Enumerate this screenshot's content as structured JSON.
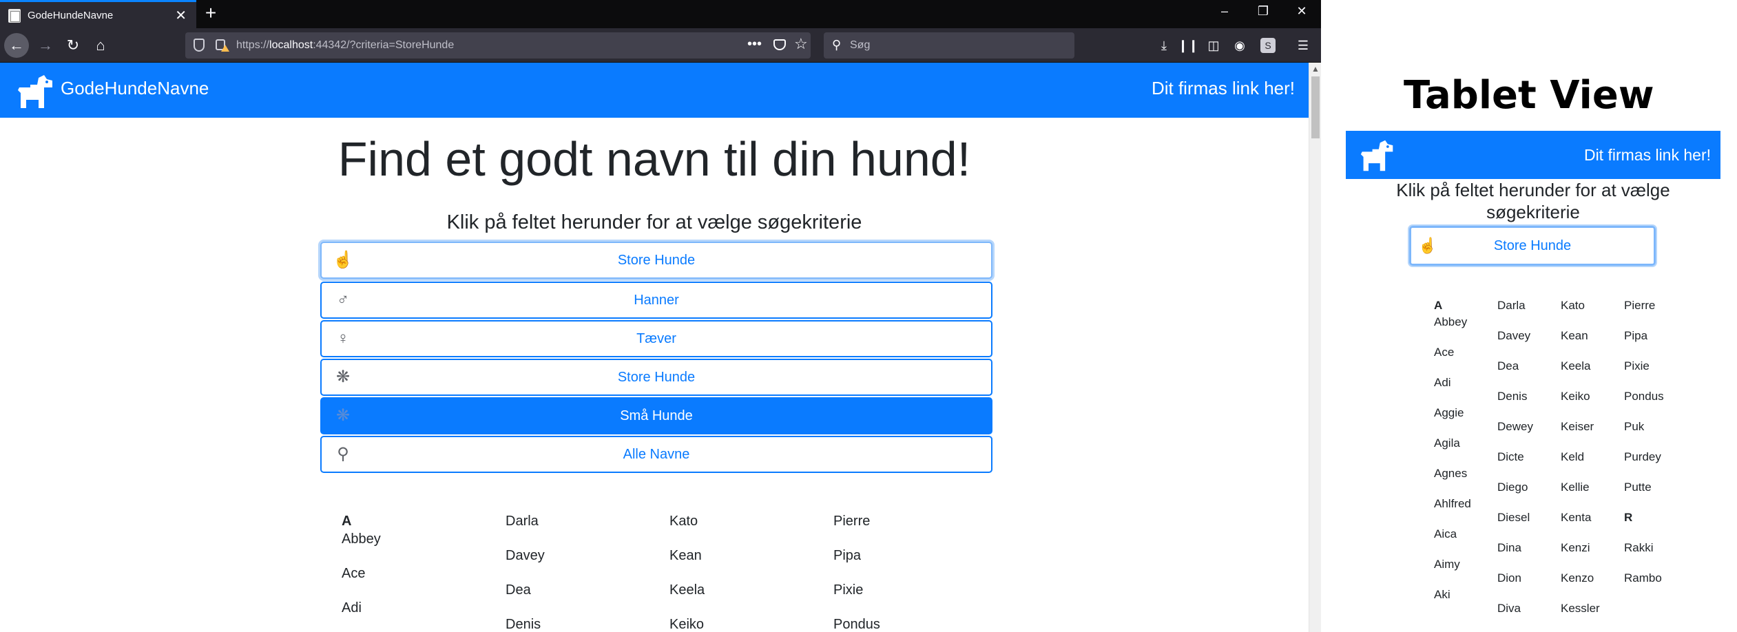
{
  "browser": {
    "tab_title": "GodeHundeNavne",
    "tab_close": "✕",
    "new_tab": "+",
    "window_controls": [
      "–",
      "❐",
      "✕"
    ],
    "url_prefix": "https://",
    "url_host": "localhost",
    "url_rest": ":44342/?criteria=StoreHunde",
    "search_placeholder": "Søg",
    "url_dots": "•••",
    "icons": [
      "back-icon",
      "forward-icon",
      "reload-icon",
      "home-icon",
      "shield-icon",
      "lock-icon",
      "pocket-icon",
      "star-icon",
      "download-icon",
      "library-icon",
      "sidebar-icon",
      "account-icon",
      "extension-icon",
      "menu-icon"
    ]
  },
  "site": {
    "brand": "GodeHundeNavne",
    "firm_link": "Dit firmas link her!",
    "headline": "Find et godt navn til din hund!",
    "subtitle": "Klik på feltet herunder for at vælge søgekriterie",
    "accent_color": "#0a7bff",
    "options": [
      {
        "label": "Store Hunde",
        "icon": "hand-pointer-icon",
        "state": "main-selector"
      },
      {
        "label": "Hanner",
        "icon": "male-icon",
        "state": "normal"
      },
      {
        "label": "Tæver",
        "icon": "female-icon",
        "state": "normal"
      },
      {
        "label": "Store Hunde",
        "icon": "paw-icon",
        "state": "normal"
      },
      {
        "label": "Små Hunde",
        "icon": "small-paw-icon",
        "state": "selected"
      },
      {
        "label": "Alle Navne",
        "icon": "search-icon",
        "state": "normal"
      }
    ],
    "names": {
      "col1": [
        {
          "letter": "A"
        },
        "Abbey",
        "Ace",
        "Adi"
      ],
      "col2": [
        "Darla",
        "Davey",
        "Dea",
        "Denis"
      ],
      "col3": [
        "Kato",
        "Kean",
        "Keela",
        "Keiko"
      ],
      "col4": [
        "Pierre",
        "Pipa",
        "Pixie",
        "Pondus"
      ]
    }
  },
  "tablet": {
    "heading": "Tablet View",
    "firm_link": "Dit firmas link her!",
    "subtitle_line1": "Klik på feltet herunder for at vælge",
    "subtitle_line2": "søgekriterie",
    "selector_label": "Store Hunde",
    "col1_letter": "A",
    "col1": [
      "Abbey",
      "Ace",
      "Adi",
      "Aggie",
      "Agila",
      "Agnes",
      "Ahlfred",
      "Aica",
      "Aimy",
      "Aki"
    ],
    "col2": [
      "Darla",
      "Davey",
      "Dea",
      "Denis",
      "Dewey",
      "Dicte",
      "Diego",
      "Diesel",
      "Dina",
      "Dion",
      "Diva"
    ],
    "col3": [
      "Kato",
      "Kean",
      "Keela",
      "Keiko",
      "Keiser",
      "Keld",
      "Kellie",
      "Kenta",
      "Kenzi",
      "Kenzo",
      "Kessler"
    ],
    "col4": [
      "Pierre",
      "Pipa",
      "Pixie",
      "Pondus",
      "Puk",
      "Purdey",
      "Putte"
    ],
    "col4_letter": "R",
    "col4b": [
      "Rakki",
      "Rambo"
    ]
  }
}
